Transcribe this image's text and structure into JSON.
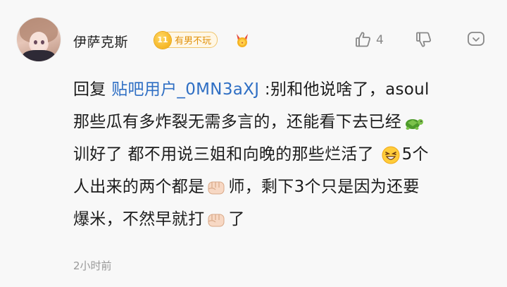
{
  "comment": {
    "author": {
      "name": "伊萨克斯",
      "level": "11",
      "level_title": "有男不玩"
    },
    "actions": {
      "like_count": "4"
    },
    "reply_prefix": "回复",
    "mention": "贴吧用户_0MN3aXJ",
    "line1_rest": ":别和他说啥了，asoul",
    "line2": "那些瓜有多炸裂无需多言的，还能看下去已经",
    "line3": "训好了 都不用说三姐和向晚的那些烂活了 ",
    "line3_tail": "5个",
    "line4_a": "人出来的两个都是",
    "line4_b": "师，剩下3个只是因为还要",
    "line5_a": "爆米，不然早就打",
    "line5_b": "了",
    "timestamp": "2小时前"
  },
  "colors": {
    "mention": "#2f6fc4",
    "badge": "#f2a80a",
    "meta": "#999999"
  },
  "icons": [
    "like-icon",
    "dislike-icon",
    "more-icon",
    "medal-icon",
    "turtle-emoji",
    "grin-emoji",
    "fist-emoji"
  ]
}
